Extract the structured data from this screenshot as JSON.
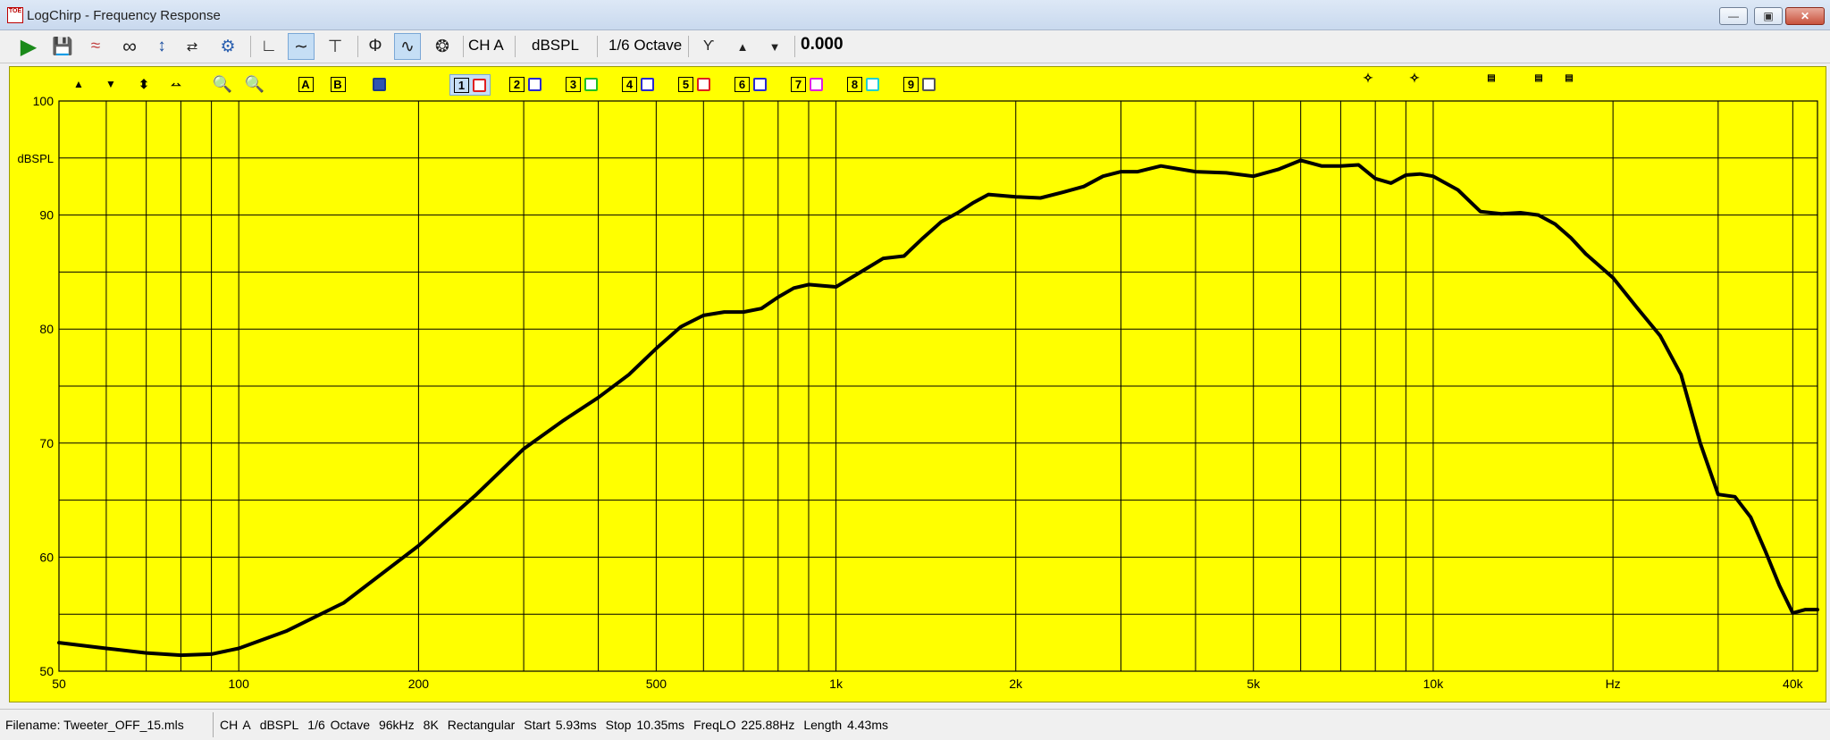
{
  "window": {
    "title": "LogChirp - Frequency Response",
    "icon_text": "TOE"
  },
  "toolbar": {
    "channel": "CH A",
    "unit": "dBSPL",
    "smoothing": "1/6 Octave",
    "value": "0.000"
  },
  "plot_toolbar": {
    "marker_a": "A",
    "marker_b": "B",
    "slots": [
      {
        "label": "1",
        "color": "#e02020"
      },
      {
        "label": "2",
        "color": "#2a2ad0"
      },
      {
        "label": "3",
        "color": "#20c020"
      },
      {
        "label": "4",
        "color": "#2a2ad0"
      },
      {
        "label": "5",
        "color": "#e02020"
      },
      {
        "label": "6",
        "color": "#2a2ad0"
      },
      {
        "label": "7",
        "color": "#e020e0"
      },
      {
        "label": "8",
        "color": "#20d0d0"
      },
      {
        "label": "9",
        "color": "#555555"
      }
    ]
  },
  "chart_data": {
    "type": "line",
    "title": "",
    "xlabel": "Hz",
    "ylabel": "dBSPL",
    "x_scale": "log",
    "xlim": [
      50,
      44000
    ],
    "ylim": [
      50,
      100
    ],
    "grid": true,
    "background": "#ffff00",
    "line_color": "#000000",
    "y_ticks": [
      "50",
      "60",
      "70",
      "80",
      "90",
      "100"
    ],
    "x_ticks": [
      {
        "value": 50,
        "label": "50"
      },
      {
        "value": 100,
        "label": "100"
      },
      {
        "value": 200,
        "label": "200"
      },
      {
        "value": 500,
        "label": "500"
      },
      {
        "value": 1000,
        "label": "1k"
      },
      {
        "value": 2000,
        "label": "2k"
      },
      {
        "value": 5000,
        "label": "5k"
      },
      {
        "value": 10000,
        "label": "10k"
      },
      {
        "value": 20000,
        "label": "Hz"
      },
      {
        "value": 40000,
        "label": "40k"
      }
    ],
    "series": [
      {
        "x": [
          50,
          60,
          70,
          80,
          90,
          100,
          120,
          150,
          200,
          250,
          300,
          350,
          400,
          450,
          500,
          550,
          600,
          650,
          700,
          750,
          800,
          850,
          900,
          950,
          1000,
          1100,
          1200,
          1300,
          1400,
          1500,
          1600,
          1700,
          1800,
          2000,
          2200,
          2400,
          2600,
          2800,
          3000,
          3200,
          3500,
          4000,
          4500,
          5000,
          5500,
          6000,
          6500,
          7000,
          7500,
          8000,
          8500,
          9000,
          9500,
          10000,
          11000,
          12000,
          13000,
          14000,
          15000,
          16000,
          17000,
          18000,
          20000,
          22000,
          24000,
          26000,
          28000,
          30000,
          32000,
          34000,
          36000,
          38000,
          40000,
          42000,
          44000
        ],
        "y": [
          52.5,
          52.0,
          51.6,
          51.4,
          51.5,
          52.0,
          53.5,
          56.0,
          61.0,
          65.5,
          69.5,
          72.0,
          74.0,
          76.0,
          78.3,
          80.2,
          81.2,
          81.5,
          81.5,
          81.8,
          82.8,
          83.6,
          83.9,
          83.8,
          83.7,
          85.0,
          86.2,
          86.4,
          88.0,
          89.4,
          90.2,
          91.1,
          91.8,
          91.6,
          91.5,
          92.0,
          92.5,
          93.4,
          93.8,
          93.8,
          94.3,
          93.8,
          93.7,
          93.4,
          94.0,
          94.8,
          94.3,
          94.3,
          94.4,
          93.2,
          92.8,
          93.5,
          93.6,
          93.4,
          92.2,
          90.3,
          90.1,
          90.2,
          90.0,
          89.2,
          88.0,
          86.6,
          84.5,
          81.8,
          79.4,
          76.0,
          70.0,
          65.5,
          65.3,
          63.5,
          60.5,
          57.5,
          55.1,
          55.4,
          55.4
        ]
      }
    ]
  },
  "status": {
    "filename": "Filename: Tweeter_OFF_15.mls",
    "channel": "CH A",
    "unit": "dBSPL",
    "smoothing": "1/6 Octave",
    "rate": "96kHz",
    "size": "8K",
    "window": "Rectangular",
    "start": "Start 5.93ms",
    "stop": "Stop 10.35ms",
    "freqlo": "FreqLO 225.88Hz",
    "length": "Length 4.43ms"
  }
}
